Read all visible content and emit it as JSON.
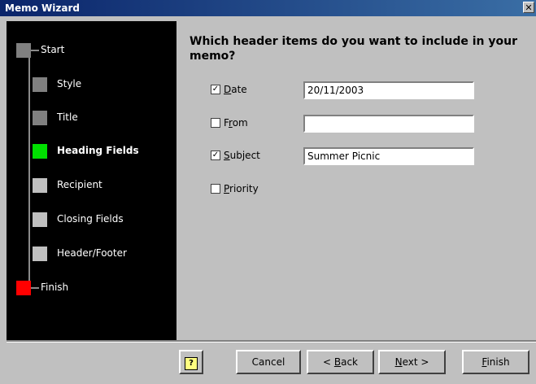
{
  "window": {
    "title": "Memo Wizard",
    "close_symbol": "✕"
  },
  "steps": [
    {
      "label": "Start",
      "state": "start"
    },
    {
      "label": "Style",
      "state": "done"
    },
    {
      "label": "Title",
      "state": "done"
    },
    {
      "label": "Heading Fields",
      "state": "current"
    },
    {
      "label": "Recipient",
      "state": "todo"
    },
    {
      "label": "Closing Fields",
      "state": "todo"
    },
    {
      "label": "Header/Footer",
      "state": "todo"
    },
    {
      "label": "Finish",
      "state": "finish"
    }
  ],
  "question": "Which header items do you want to include in your memo?",
  "fields": {
    "date": {
      "checked": true,
      "mnemonic": "D",
      "rest": "ate",
      "value": "20/11/2003"
    },
    "from": {
      "checked": false,
      "pre": "F",
      "mnemonic": "r",
      "rest": "om",
      "value": ""
    },
    "subject": {
      "checked": true,
      "mnemonic": "S",
      "rest": "ubject",
      "value": "Summer Picnic"
    },
    "priority": {
      "checked": false,
      "mnemonic": "P",
      "rest": "riority"
    }
  },
  "check_mark": "✓",
  "buttons": {
    "help_symbol": "?",
    "cancel": "Cancel",
    "back_prefix": "< ",
    "back_mnemonic": "B",
    "back_rest": "ack",
    "next_mnemonic": "N",
    "next_rest": "ext >",
    "finish_mnemonic": "F",
    "finish_rest": "inish"
  },
  "colors": {
    "current_step": "#00e000",
    "finish_step": "#ff0000",
    "done_step": "#808080",
    "todo_step": "#c0c0c0",
    "start_step": "#808080"
  }
}
